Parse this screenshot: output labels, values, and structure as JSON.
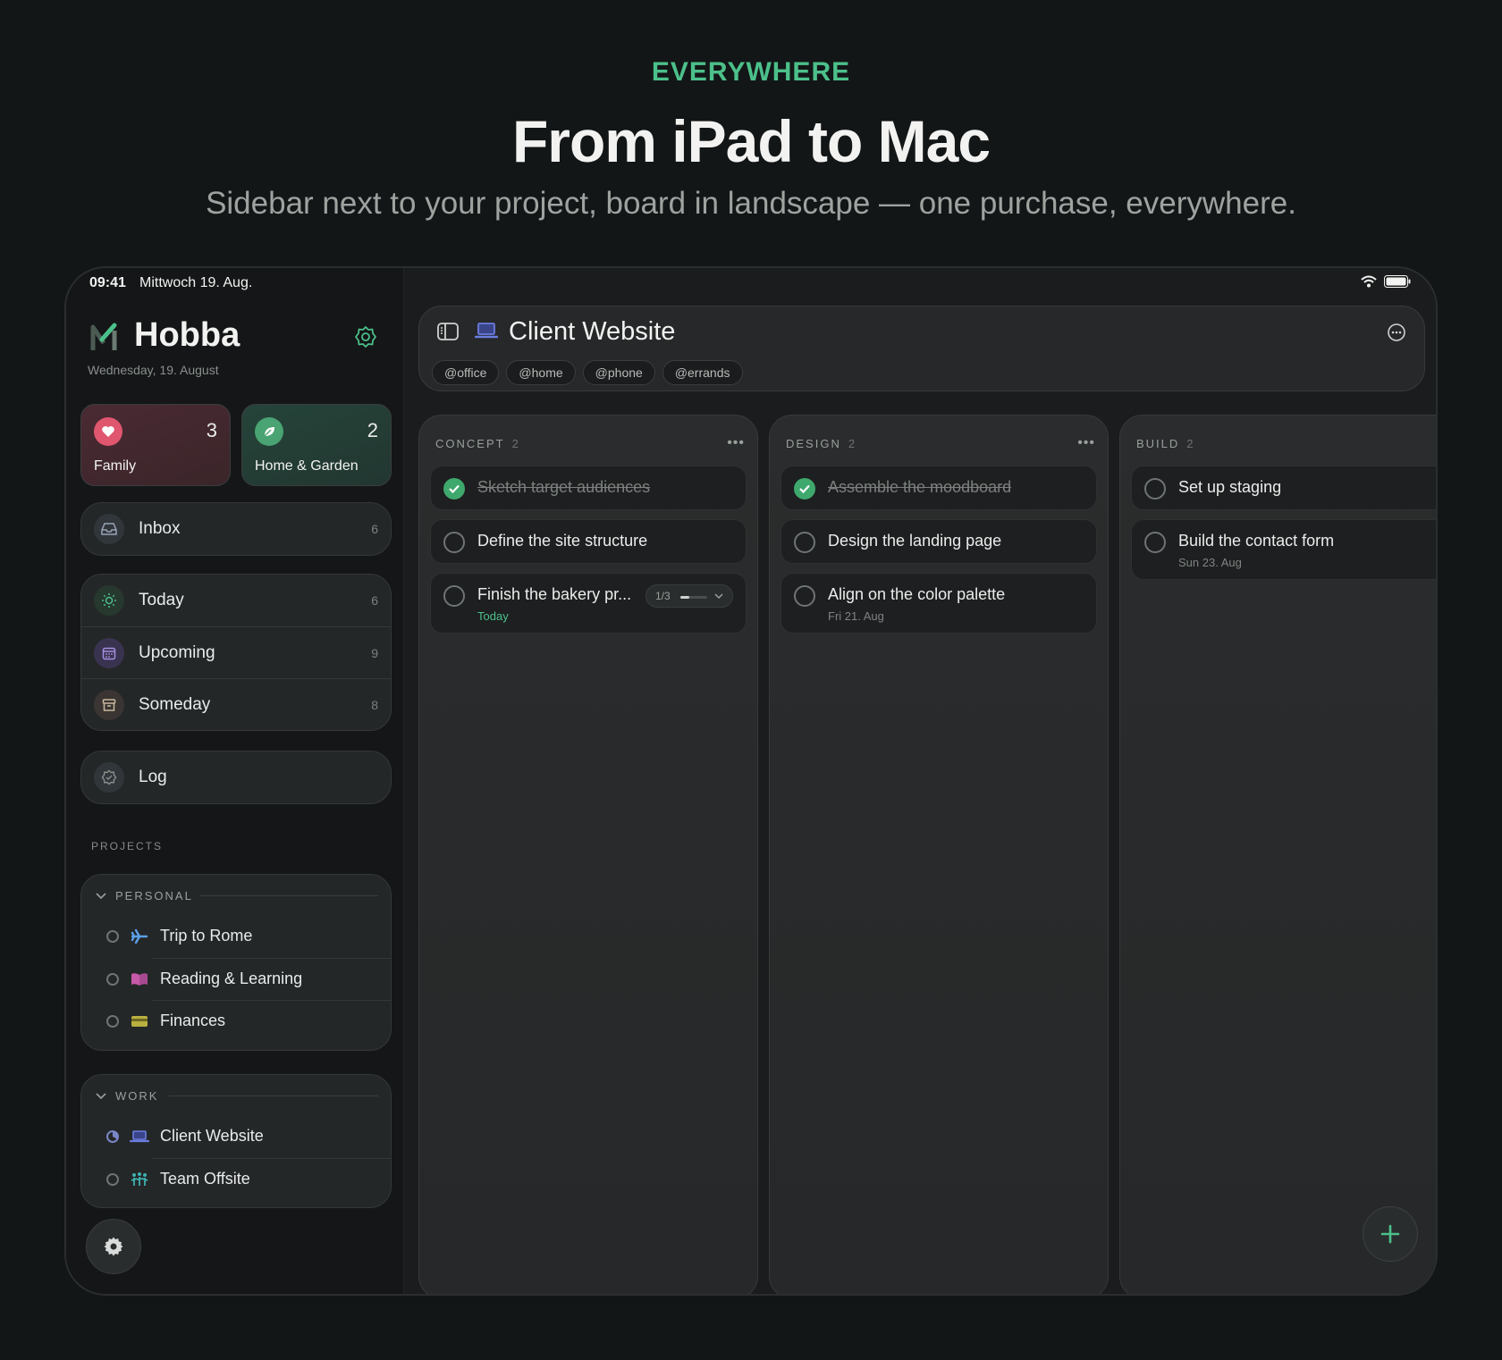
{
  "hero": {
    "eyebrow": "EVERYWHERE",
    "headline": "From iPad to Mac",
    "subhead": "Sidebar next to your project, board in landscape — one purchase, everywhere."
  },
  "status": {
    "time": "09:41",
    "date": "Mittwoch 19. Aug."
  },
  "sidebar": {
    "app_name": "Hobba",
    "date": "Wednesday, 19. August",
    "tiles": [
      {
        "label": "Family",
        "count": "3",
        "icon": "heart-icon",
        "color": "#e0566f"
      },
      {
        "label": "Home & Garden",
        "count": "2",
        "icon": "leaf-icon",
        "color": "#49a372"
      }
    ],
    "inbox": {
      "label": "Inbox",
      "count": "6"
    },
    "smart_lists": [
      {
        "label": "Today",
        "count": "6",
        "icon": "sun-icon"
      },
      {
        "label": "Upcoming",
        "count": "9",
        "icon": "calendar-icon"
      },
      {
        "label": "Someday",
        "count": "8",
        "icon": "archive-icon"
      }
    ],
    "log": {
      "label": "Log"
    },
    "projects_title": "PROJECTS",
    "personal": {
      "title": "PERSONAL",
      "items": [
        {
          "label": "Trip to Rome",
          "icon": "airplane-icon"
        },
        {
          "label": "Reading & Learning",
          "icon": "book-icon"
        },
        {
          "label": "Finances",
          "icon": "credit-card-icon"
        }
      ]
    },
    "work": {
      "title": "WORK",
      "items": [
        {
          "label": "Client Website",
          "icon": "laptop-icon"
        },
        {
          "label": "Team Offsite",
          "icon": "people-icon"
        }
      ]
    }
  },
  "project": {
    "title": "Client Website",
    "tags": [
      "@office",
      "@home",
      "@phone",
      "@errands"
    ]
  },
  "board": {
    "columns": [
      {
        "title": "CONCEPT",
        "count": "2",
        "cards": [
          {
            "title": "Sketch target audiences",
            "done": true
          },
          {
            "title": "Define the site structure",
            "done": false
          },
          {
            "title": "Finish the bakery pr...",
            "done": false,
            "sub": "Today",
            "subtasks": "1/3",
            "subtask_progress": 0.33
          }
        ]
      },
      {
        "title": "DESIGN",
        "count": "2",
        "cards": [
          {
            "title": "Assemble the moodboard",
            "done": true
          },
          {
            "title": "Design the landing page",
            "done": false
          },
          {
            "title": "Align on the color palette",
            "done": false,
            "sub": "Fri 21. Aug"
          }
        ]
      },
      {
        "title": "BUILD",
        "count": "2",
        "cards": [
          {
            "title": "Set up staging",
            "done": false
          },
          {
            "title": "Build the contact form",
            "done": false,
            "sub": "Sun 23. Aug"
          }
        ]
      }
    ]
  },
  "colors": {
    "accent": "#4cc08a",
    "done": "#3fa86d",
    "background": "#131617"
  }
}
